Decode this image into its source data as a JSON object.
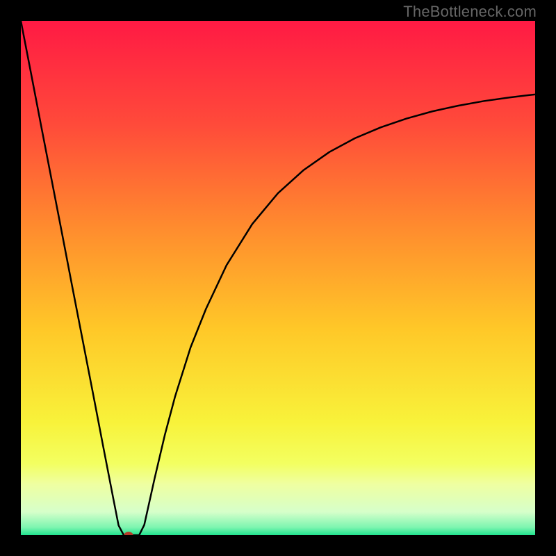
{
  "watermark": "TheBottleneck.com",
  "chart_data": {
    "type": "line",
    "title": "",
    "xlabel": "",
    "ylabel": "",
    "xlim": [
      0,
      100
    ],
    "ylim": [
      0,
      100
    ],
    "grid": false,
    "legend": false,
    "background_gradient": {
      "stops": [
        {
          "pos": 0.0,
          "color": "#ff1a44"
        },
        {
          "pos": 0.2,
          "color": "#ff4a3a"
        },
        {
          "pos": 0.4,
          "color": "#ff8b2e"
        },
        {
          "pos": 0.6,
          "color": "#ffc828"
        },
        {
          "pos": 0.78,
          "color": "#f8f23a"
        },
        {
          "pos": 0.86,
          "color": "#f3ff60"
        },
        {
          "pos": 0.9,
          "color": "#efffa0"
        },
        {
          "pos": 0.955,
          "color": "#d6ffca"
        },
        {
          "pos": 0.985,
          "color": "#7cf5b0"
        },
        {
          "pos": 1.0,
          "color": "#20e38e"
        }
      ]
    },
    "series": [
      {
        "name": "bottleneck-curve",
        "x": [
          0,
          2,
          4,
          6,
          8,
          10,
          12,
          14,
          16,
          18,
          19,
          20,
          21,
          22,
          23,
          24,
          26,
          28,
          30,
          33,
          36,
          40,
          45,
          50,
          55,
          60,
          65,
          70,
          75,
          80,
          85,
          90,
          95,
          100
        ],
        "y": [
          100,
          89.7,
          79.3,
          69.0,
          58.7,
          48.3,
          38.0,
          27.7,
          17.3,
          7.0,
          1.9,
          0.0,
          0.0,
          0.0,
          0.0,
          2.0,
          11.0,
          19.5,
          27.0,
          36.5,
          44.0,
          52.5,
          60.5,
          66.5,
          71.0,
          74.5,
          77.2,
          79.3,
          81.0,
          82.4,
          83.5,
          84.4,
          85.1,
          85.7
        ]
      }
    ],
    "marker": {
      "x": 21,
      "y": 0,
      "color": "#b43c28"
    }
  }
}
